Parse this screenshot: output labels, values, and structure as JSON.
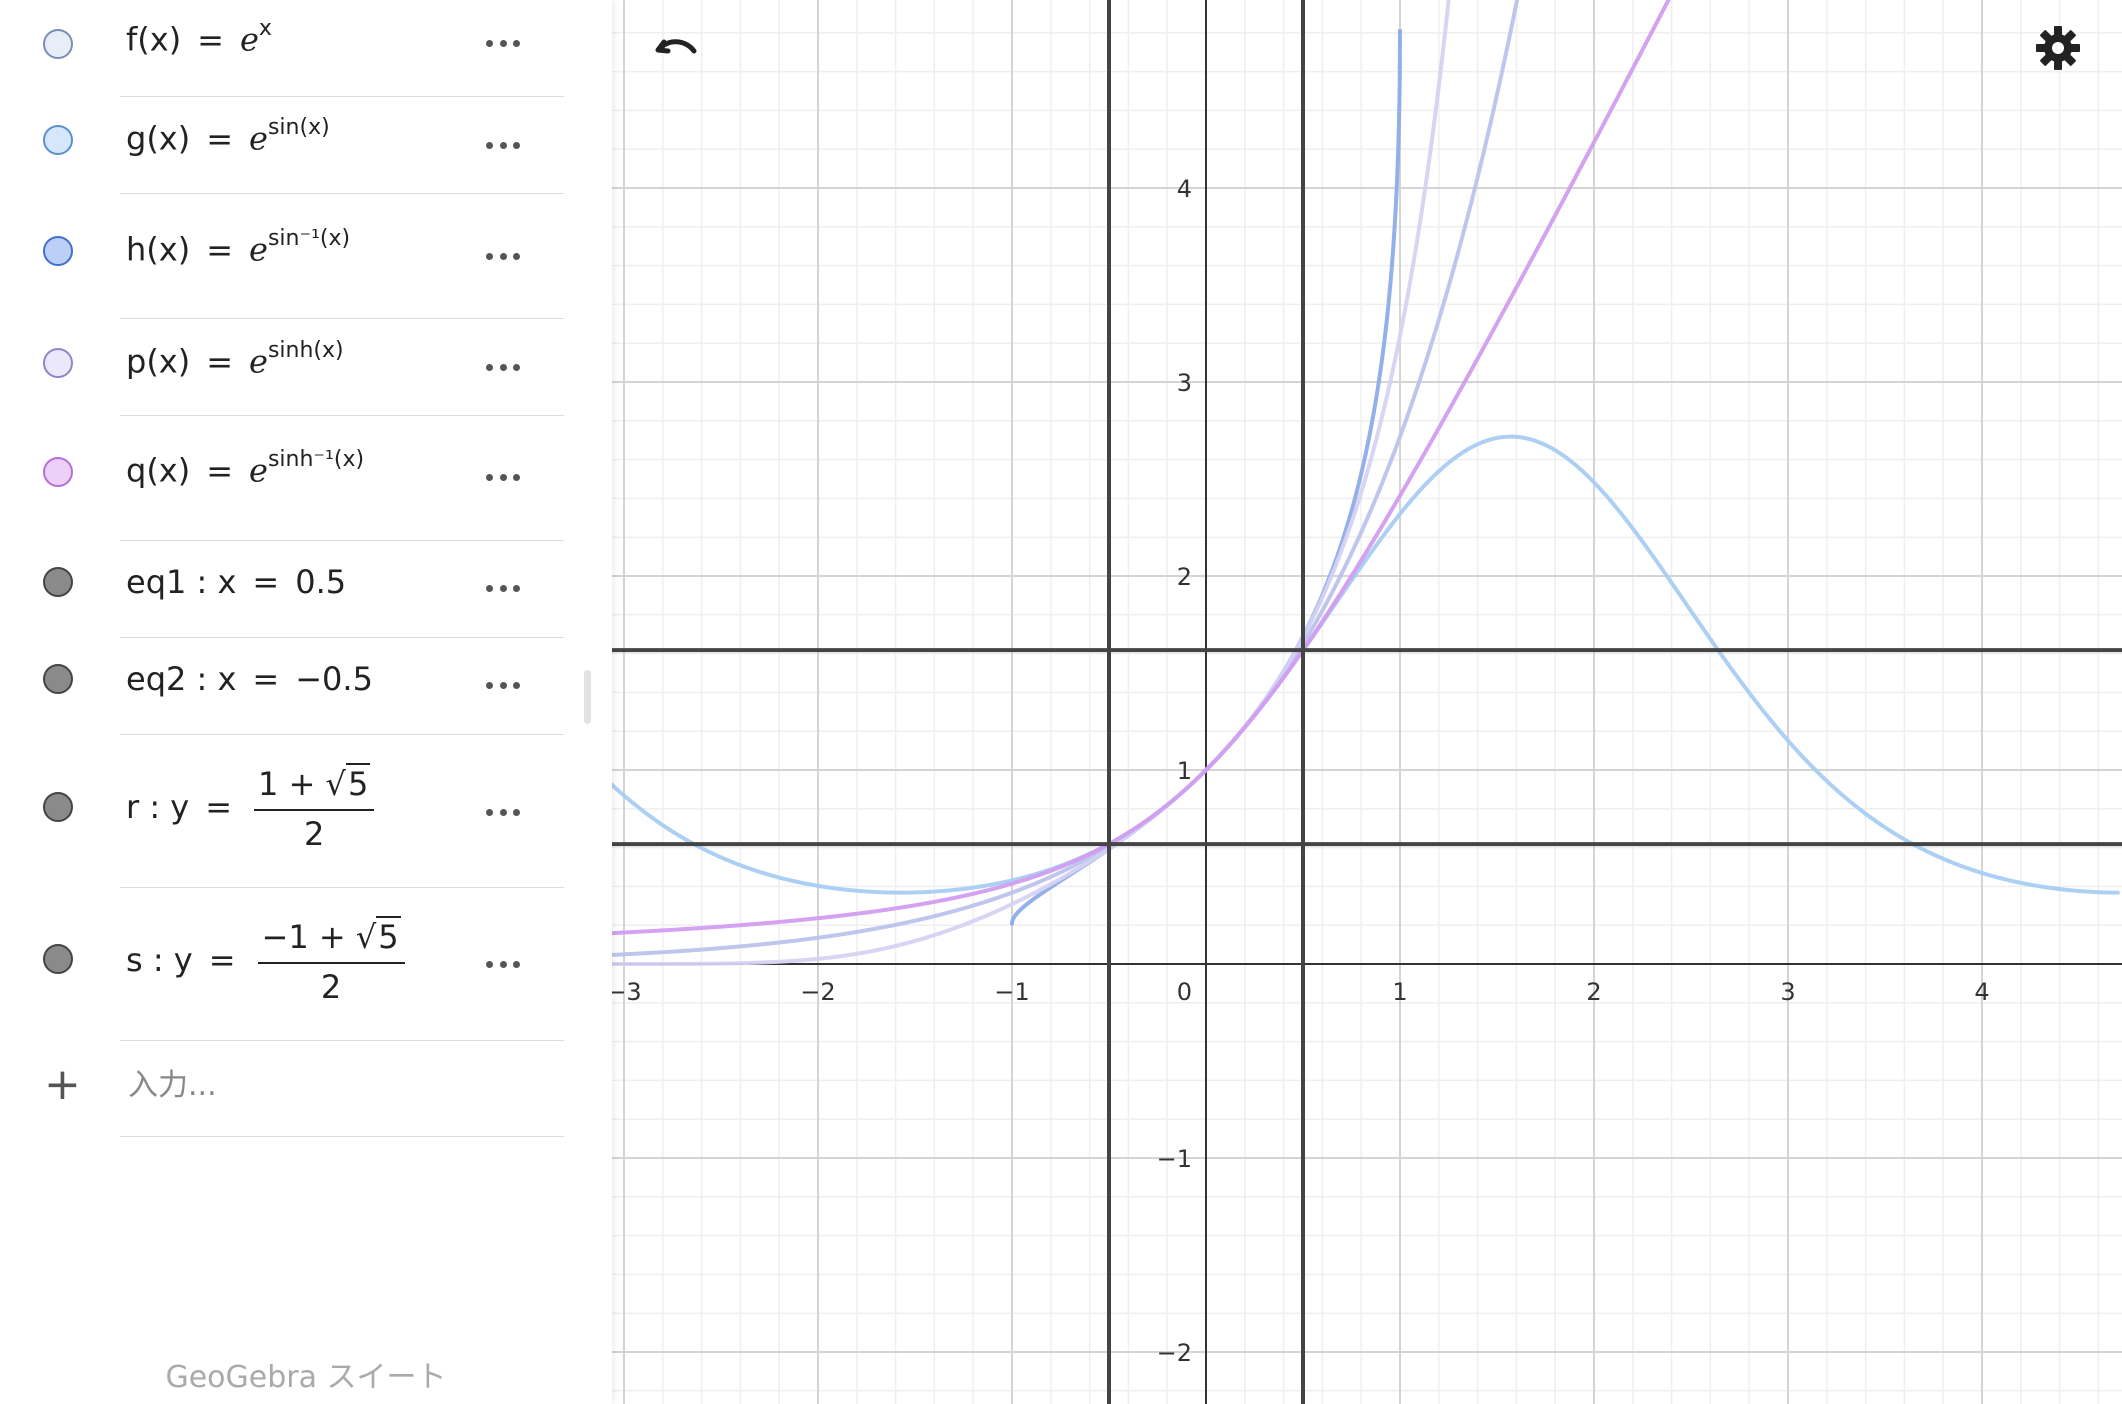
{
  "algebra": {
    "items": [
      {
        "id": "f",
        "lhs": "f(x)",
        "base": "e",
        "sup": "x",
        "color": "#e8eef8"
      },
      {
        "id": "g",
        "lhs": "g(x)",
        "base": "e",
        "sup": "sin(x)",
        "color": "#d6e6fb"
      },
      {
        "id": "h",
        "lhs": "h(x)",
        "base": "e",
        "sup": "sin⁻¹(x)",
        "color": "#bcd0f7"
      },
      {
        "id": "p",
        "lhs": "p(x)",
        "base": "e",
        "sup": "sinh(x)",
        "color": "#ece8fb"
      },
      {
        "id": "q",
        "lhs": "q(x)",
        "base": "e",
        "sup": "sinh⁻¹(x)",
        "color": "#ecd0fa"
      },
      {
        "id": "eq1",
        "lhs": "eq1 : x",
        "rhs": "0.5",
        "color": "#8a8a8a"
      },
      {
        "id": "eq2",
        "lhs": "eq2 : x",
        "rhs": "−0.5",
        "color": "#8a8a8a"
      },
      {
        "id": "r",
        "lhs": "r : y",
        "num_pre": "1 + ",
        "num_rad": "5",
        "den": "2",
        "color": "#8a8a8a"
      },
      {
        "id": "s",
        "lhs": "s : y",
        "num_pre": "−1 + ",
        "num_rad": "5",
        "den": "2",
        "color": "#8a8a8a"
      }
    ],
    "equals": "=",
    "sqrt_symbol": "√",
    "input_placeholder": "入力..."
  },
  "footer": "GeoGebra スイート",
  "toolbar": {
    "undo_icon": "undo-icon",
    "settings_icon": "gear-icon"
  },
  "chart_data": {
    "type": "line",
    "xlim": [
      -3.1,
      4.7
    ],
    "ylim": [
      -2.25,
      4.95
    ],
    "x_ticks": [
      -3,
      -2,
      -1,
      1,
      2,
      3,
      4
    ],
    "y_ticks": [
      -2,
      -1,
      1,
      2,
      3,
      4
    ],
    "origin_label": "0",
    "grid": true,
    "series": [
      {
        "name": "f",
        "expr": "exp(x)",
        "color": "#bcc3ec",
        "domain": [
          -3.1,
          4.7
        ]
      },
      {
        "name": "g",
        "expr": "exp(sin(x))",
        "color": "#a8cdf2",
        "domain": [
          -3.1,
          4.7
        ]
      },
      {
        "name": "h",
        "expr": "exp(asin(x))",
        "color": "#8cace8",
        "domain": [
          -1,
          1
        ]
      },
      {
        "name": "p",
        "expr": "exp(sinh(x))",
        "color": "#d6d2f2",
        "domain": [
          -3.1,
          4.7
        ]
      },
      {
        "name": "q",
        "expr": "exp(asinh(x))",
        "color": "#d39cf0",
        "domain": [
          -3.1,
          4.7
        ]
      }
    ],
    "vertical_lines": [
      {
        "name": "eq1",
        "x": 0.5,
        "color": "#444444"
      },
      {
        "name": "eq2",
        "x": -0.5,
        "color": "#444444"
      }
    ],
    "horizontal_lines": [
      {
        "name": "r",
        "y": 1.618,
        "color": "#444444"
      },
      {
        "name": "s",
        "y": 0.618,
        "color": "#444444"
      }
    ]
  }
}
